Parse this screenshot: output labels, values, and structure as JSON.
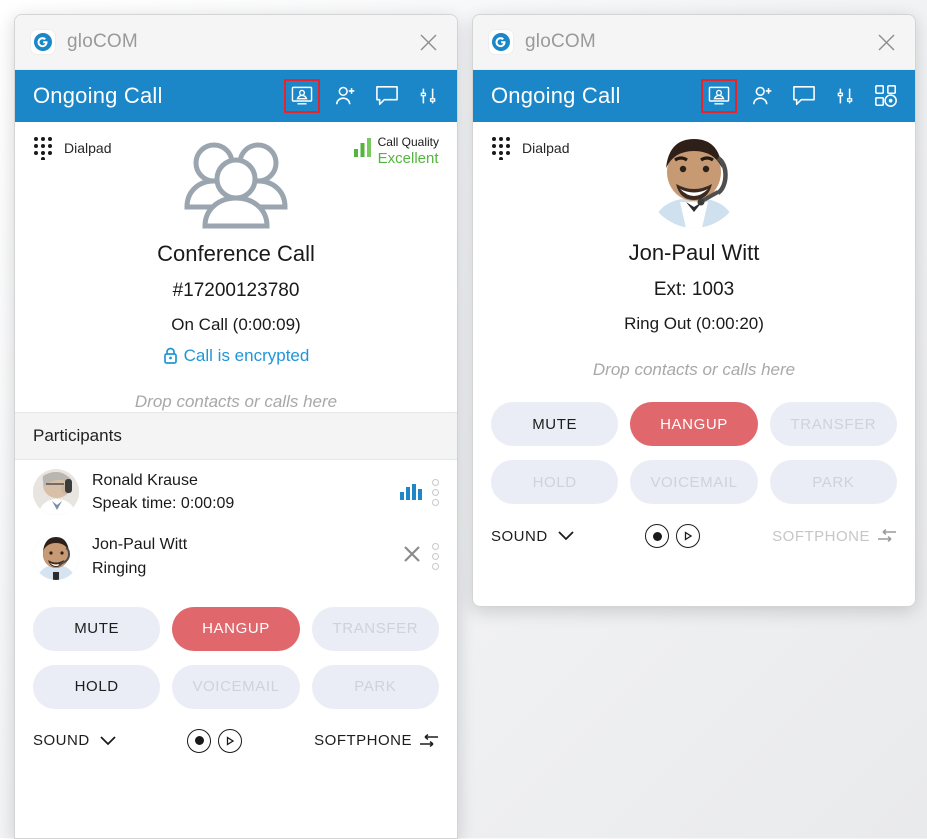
{
  "app": {
    "name": "gloCOM",
    "logo_icon": "glocom-logo-icon",
    "close_icon": "close-icon"
  },
  "windows": [
    {
      "id": "conference",
      "header": {
        "title": "Ongoing Call",
        "accent_color": "#1b87c9",
        "highlight_color": "#e8232a",
        "icons": [
          {
            "name": "video-presentation-icon",
            "highlighted": true
          },
          {
            "name": "add-participant-icon",
            "highlighted": false
          },
          {
            "name": "chat-icon",
            "highlighted": false
          },
          {
            "name": "equalizer-sliders-icon",
            "highlighted": false
          }
        ]
      },
      "dialpad": {
        "label": "Dialpad",
        "icon": "dialpad-icon"
      },
      "quality": {
        "label": "Call Quality",
        "value": "Excellent",
        "icon": "signal-bars-icon",
        "color": "#52b63e"
      },
      "call": {
        "avatar_icon": "conference-group-icon",
        "name": "Conference Call",
        "number": "#17200123780",
        "status": "On Call (0:00:09)",
        "encrypted_label": "Call is encrypted",
        "encrypted_icon": "lock-icon",
        "drop_hint": "Drop contacts or calls here"
      },
      "participants": {
        "title": "Participants",
        "rows": [
          {
            "name": "Ronald Krause",
            "detail": "Speak time: 0:00:09",
            "avatar": "avatar-ronald-krause",
            "has_equalizer": true,
            "has_remove": false,
            "menu_icon": "kebab-menu-icon"
          },
          {
            "name": "Jon-Paul Witt",
            "detail": "Ringing",
            "avatar": "avatar-jon-paul-witt",
            "has_equalizer": false,
            "has_remove": true,
            "remove_icon": "remove-x-icon",
            "menu_icon": "kebab-menu-icon"
          }
        ]
      },
      "buttons": [
        {
          "label": "MUTE",
          "state": "enabled"
        },
        {
          "label": "HANGUP",
          "state": "danger"
        },
        {
          "label": "TRANSFER",
          "state": "disabled"
        },
        {
          "label": "HOLD",
          "state": "enabled"
        },
        {
          "label": "VOICEMAIL",
          "state": "disabled"
        },
        {
          "label": "PARK",
          "state": "disabled"
        }
      ],
      "footer": {
        "sound_label": "SOUND",
        "sound_icon": "chevron-down-icon",
        "record_icon": "record-icon",
        "play_icon": "play-icon",
        "softphone_label": "SOFTPHONE",
        "softphone_icon": "switch-arrows-icon",
        "softphone_state": "enabled"
      }
    },
    {
      "id": "direct-call",
      "header": {
        "title": "Ongoing Call",
        "accent_color": "#1b87c9",
        "highlight_color": "#e8232a",
        "icons": [
          {
            "name": "video-presentation-icon",
            "highlighted": true
          },
          {
            "name": "add-participant-icon",
            "highlighted": false
          },
          {
            "name": "chat-icon",
            "highlighted": false
          },
          {
            "name": "equalizer-sliders-icon",
            "highlighted": false
          },
          {
            "name": "qr-scan-icon",
            "highlighted": false
          }
        ]
      },
      "dialpad": {
        "label": "Dialpad",
        "icon": "dialpad-icon"
      },
      "call": {
        "avatar": "avatar-jon-paul-witt",
        "name": "Jon-Paul Witt",
        "number": "Ext: 1003",
        "status": "Ring Out (0:00:20)",
        "drop_hint": "Drop contacts or calls here"
      },
      "buttons": [
        {
          "label": "MUTE",
          "state": "enabled"
        },
        {
          "label": "HANGUP",
          "state": "danger"
        },
        {
          "label": "TRANSFER",
          "state": "disabled"
        },
        {
          "label": "HOLD",
          "state": "disabled"
        },
        {
          "label": "VOICEMAIL",
          "state": "disabled"
        },
        {
          "label": "PARK",
          "state": "disabled"
        }
      ],
      "footer": {
        "sound_label": "SOUND",
        "sound_icon": "chevron-down-icon",
        "record_icon": "record-icon",
        "play_icon": "play-icon",
        "softphone_label": "SOFTPHONE",
        "softphone_icon": "switch-arrows-icon",
        "softphone_state": "disabled"
      }
    }
  ]
}
